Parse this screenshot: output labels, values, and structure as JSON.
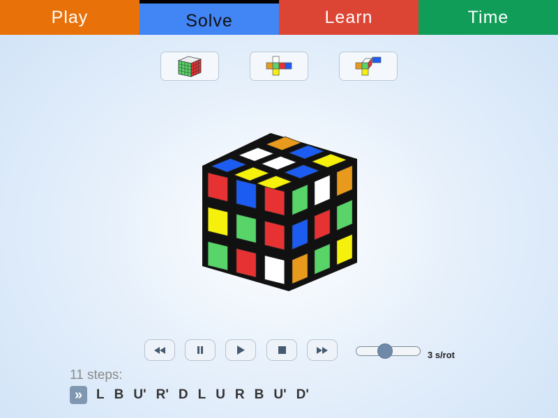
{
  "tabs": [
    {
      "label": "Play",
      "color": "#e8710a",
      "active": false
    },
    {
      "label": "Solve",
      "color": "#4285f4",
      "active": true
    },
    {
      "label": "Learn",
      "color": "#dc4534",
      "active": false
    },
    {
      "label": "Time",
      "color": "#0f9d58",
      "active": false
    }
  ],
  "views": [
    {
      "name": "3d-view-icon",
      "active": true
    },
    {
      "name": "flat-net-view-icon",
      "active": false
    },
    {
      "name": "folded-net-view-icon",
      "active": false
    }
  ],
  "colors": {
    "yellow": "#f5f00c",
    "blue": "#1d5cf0",
    "white": "#ffffff",
    "orange": "#e89a1c",
    "red": "#e63232",
    "green": "#58d468"
  },
  "cube": {
    "up": [
      [
        "yellow",
        "blue",
        "yellow"
      ],
      [
        "yellow",
        "white",
        "blue"
      ],
      [
        "blue",
        "white",
        "orange"
      ]
    ],
    "front": [
      [
        "red",
        "blue",
        "red"
      ],
      [
        "yellow",
        "green",
        "red"
      ],
      [
        "green",
        "red",
        "white"
      ]
    ],
    "right": [
      [
        "green",
        "white",
        "orange"
      ],
      [
        "blue",
        "red",
        "green"
      ],
      [
        "orange",
        "green",
        "yellow"
      ]
    ]
  },
  "playback": {
    "buttons": [
      {
        "name": "rewind-button",
        "icon": "rewind-icon"
      },
      {
        "name": "pause-button",
        "icon": "pause-icon"
      },
      {
        "name": "play-button",
        "icon": "play-icon"
      },
      {
        "name": "stop-button",
        "icon": "stop-icon"
      },
      {
        "name": "fast-forward-button",
        "icon": "fast-forward-icon"
      }
    ],
    "speed_value": 0.45,
    "speed_label": "3 s/rot"
  },
  "solution": {
    "steps_label": "11 steps:",
    "expand_icon": "»",
    "moves": [
      "L",
      "B",
      "U'",
      "R'",
      "D",
      "L",
      "U",
      "R",
      "B",
      "U'",
      "D'"
    ]
  }
}
